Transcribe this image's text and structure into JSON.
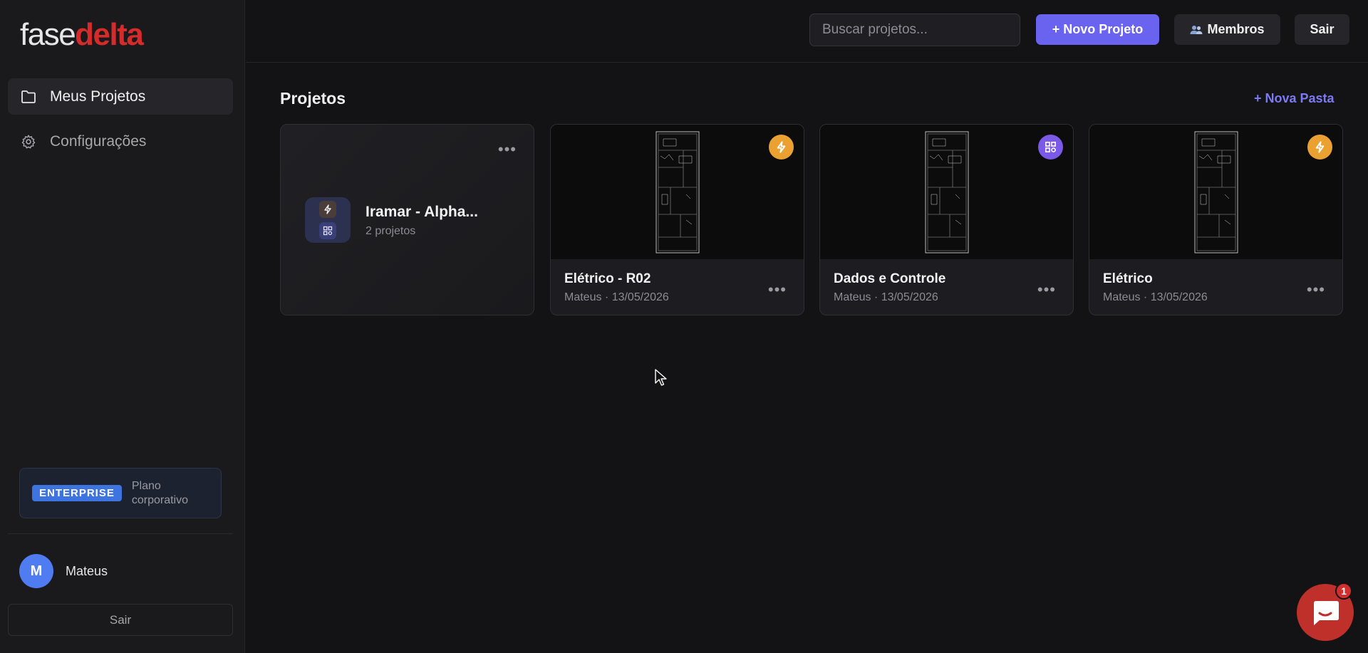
{
  "brand": {
    "part1": "fase",
    "part2": "delta",
    "accent": "#d72b2b"
  },
  "sidebar": {
    "items": [
      {
        "label": "Meus Projetos",
        "icon": "folder-icon",
        "active": true
      },
      {
        "label": "Configurações",
        "icon": "gear-icon",
        "active": false
      }
    ],
    "plan": {
      "badge": "ENTERPRISE",
      "text": "Plano corporativo"
    },
    "user": {
      "initial": "M",
      "name": "Mateus"
    },
    "logout_label": "Sair"
  },
  "topbar": {
    "search_placeholder": "Buscar projetos...",
    "new_project_label": "+ Novo Projeto",
    "members_label": "Membros",
    "logout_label": "Sair"
  },
  "main": {
    "title": "Projetos",
    "new_folder_label": "+ Nova Pasta",
    "folder": {
      "name": "Iramar - Alpha...",
      "count": "2 projetos"
    },
    "projects": [
      {
        "title": "Elétrico - R02",
        "meta": "Mateus · 13/05/2026",
        "badge": "bolt-icon",
        "badge_color": "#eaa132"
      },
      {
        "title": "Dados e Controle",
        "meta": "Mateus · 13/05/2026",
        "badge": "grid-icon",
        "badge_color": "#7a5ae6"
      },
      {
        "title": "Elétrico",
        "meta": "Mateus · 13/05/2026",
        "badge": "bolt-icon",
        "badge_color": "#eaa132"
      }
    ]
  },
  "chat": {
    "unread": "1"
  },
  "colors": {
    "primary": "#6a63f0",
    "background": "#131316",
    "sidebar": "#1a1a1d"
  }
}
